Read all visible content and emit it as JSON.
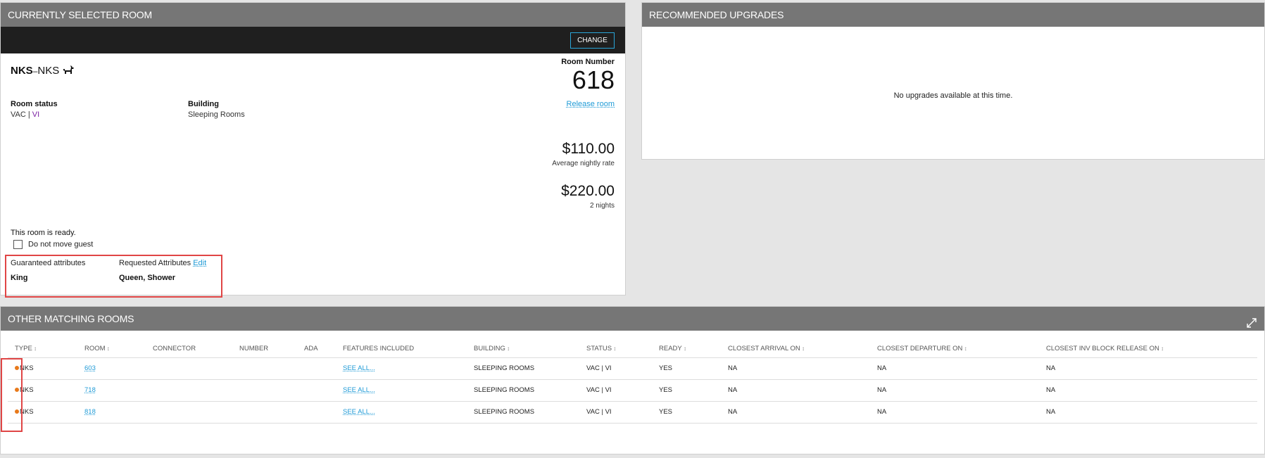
{
  "selected_room": {
    "header": "CURRENTLY SELECTED ROOM",
    "change_label": "CHANGE",
    "room_type_code": "NKS",
    "room_type_sep": "–",
    "room_type_sub": "NKS",
    "room_number_label": "Room Number",
    "room_number": "618",
    "release_label": "Release room",
    "room_status_label": "Room status",
    "room_status_a": "VAC",
    "room_status_sep": " | ",
    "room_status_b": "VI",
    "building_label": "Building",
    "building_value": "Sleeping Rooms",
    "avg_rate": "$110.00",
    "avg_rate_label": "Average nightly rate",
    "total_rate": "$220.00",
    "nights_label": "2 nights",
    "ready_text": "This room is ready.",
    "do_not_move_label": "Do not move guest",
    "guaranteed_label": "Guaranteed attributes",
    "guaranteed_value": "King",
    "requested_label": "Requested Attributes",
    "edit_label": "Edit",
    "requested_value": "Queen, Shower",
    "icons": {
      "pet": "dog-icon"
    }
  },
  "upgrades": {
    "header": "RECOMMENDED UPGRADES",
    "empty_text": "No upgrades available at this time."
  },
  "matching": {
    "header": "OTHER MATCHING ROOMS",
    "columns": [
      "TYPE",
      "ROOM",
      "CONNECTOR",
      "NUMBER",
      "ADA",
      "FEATURES INCLUDED",
      "BUILDING",
      "STATUS",
      "READY",
      "CLOSEST ARRIVAL ON",
      "CLOSEST DEPARTURE ON",
      "CLOSEST INV BLOCK RELEASE ON"
    ],
    "sortable": [
      true,
      true,
      false,
      false,
      false,
      false,
      true,
      true,
      true,
      true,
      true,
      true
    ],
    "rows": [
      {
        "type": "NKS",
        "room": "603",
        "connector": "",
        "number": "",
        "ada": "",
        "features": "SEE ALL...",
        "building": "SLEEPING ROOMS",
        "status": "VAC | VI",
        "ready": "YES",
        "arrival": "NA",
        "departure": "NA",
        "release": "NA"
      },
      {
        "type": "NKS",
        "room": "718",
        "connector": "",
        "number": "",
        "ada": "",
        "features": "SEE ALL...",
        "building": "SLEEPING ROOMS",
        "status": "VAC | VI",
        "ready": "YES",
        "arrival": "NA",
        "departure": "NA",
        "release": "NA"
      },
      {
        "type": "NKS",
        "room": "818",
        "connector": "",
        "number": "",
        "ada": "",
        "features": "SEE ALL...",
        "building": "SLEEPING ROOMS",
        "status": "VAC | VI",
        "ready": "YES",
        "arrival": "NA",
        "departure": "NA",
        "release": "NA"
      }
    ],
    "icons": {
      "expand": "expand-icon",
      "sort": "sort-icon",
      "status_dot": "status-dot"
    },
    "colors": {
      "dot": "#e8791a",
      "link": "#1e9ad6",
      "highlight": "#e04545"
    }
  }
}
